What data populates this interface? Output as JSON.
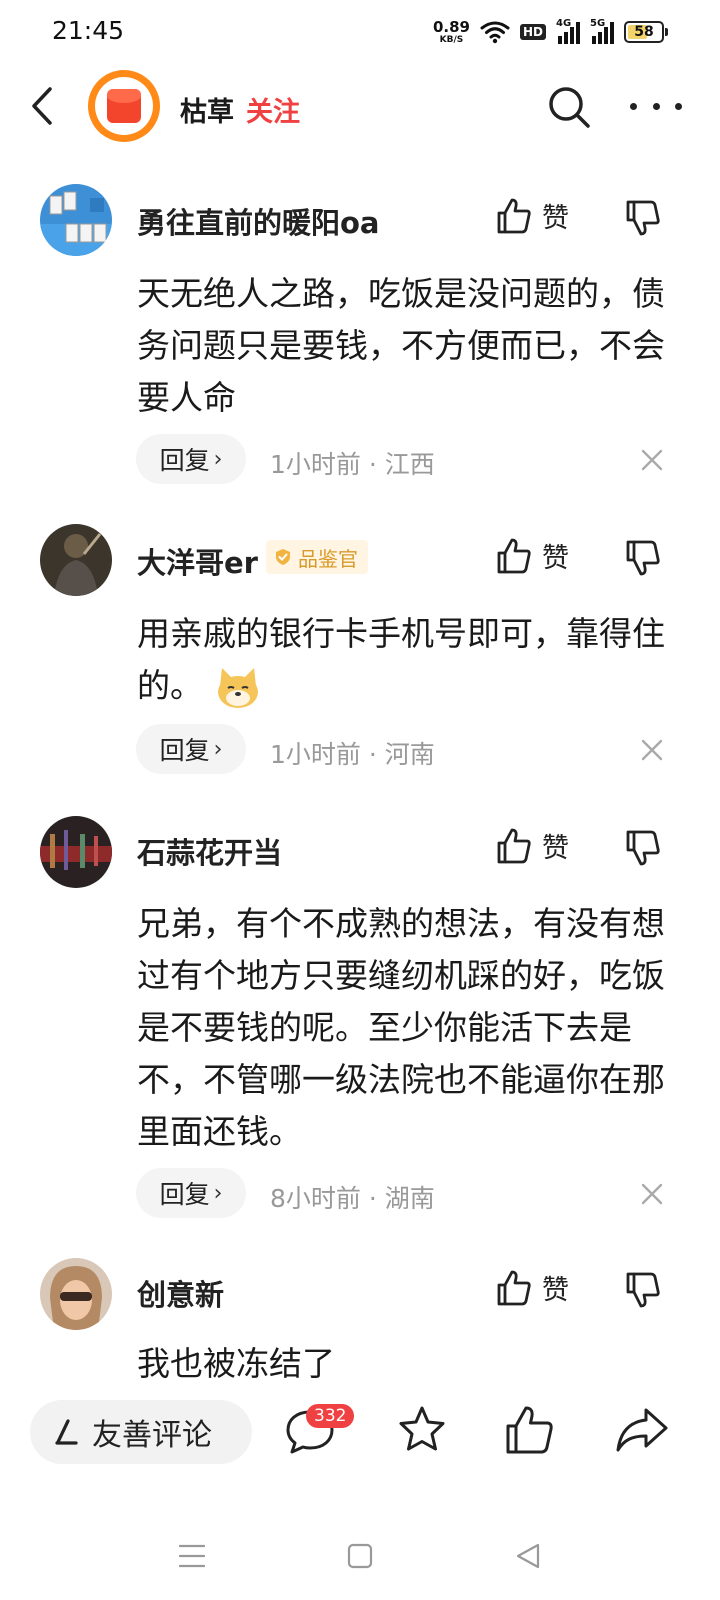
{
  "status_bar": {
    "time": "21:45",
    "net_speed_value": "0.89",
    "net_speed_unit": "KB/S",
    "hd_label": "HD",
    "signal1_label": "4G",
    "signal2_label": "5G",
    "battery": "58",
    "battery_level": 0.58
  },
  "header": {
    "author_name": "枯草",
    "follow_label": "关注",
    "icons": [
      "back-arrow-icon",
      "search-icon",
      "more-dots-icon"
    ]
  },
  "comments": [
    {
      "name": "勇往直前的暖阳oa",
      "like_label": "赞",
      "text": "天无绝人之路，吃饭是没问题的，债务问题只是要钱，不方便而已，不会要人命",
      "reply_label": "回复",
      "meta": "1小时前 · 江西"
    },
    {
      "name": "大洋哥er",
      "badge": "品鉴官",
      "like_label": "赞",
      "text": "用亲戚的银行卡手机号即可，靠得住的。",
      "reply_label": "回复",
      "meta": "1小时前 · 河南"
    },
    {
      "name": "石蒜花开当",
      "like_label": "赞",
      "text": "兄弟，有个不成熟的想法，有没有想过有个地方只要缝纫机踩的好，吃饭是不要钱的呢。至少你能活下去是不，不管哪一级法院也不能逼你在那里面还钱。",
      "reply_label": "回复",
      "meta": "8小时前 · 湖南"
    },
    {
      "name": "创意新",
      "like_label": "赞",
      "text": "我也被冻结了"
    }
  ],
  "bottom_bar": {
    "input_label": "友善评论",
    "comment_count": "332",
    "icons": [
      "comment-icon",
      "star-icon",
      "thumb-up-icon",
      "share-icon"
    ]
  },
  "colors": {
    "accent_red": "#f04142",
    "avatar_orange": "#ff8a17",
    "badge_gold": "#d99a2b",
    "meta_gray": "#999999"
  }
}
